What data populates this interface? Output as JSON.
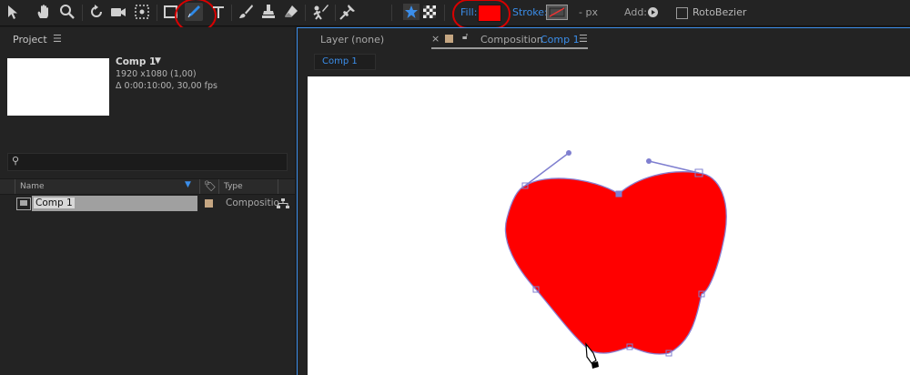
{
  "toolbar": {
    "fill_label": "Fill:",
    "fill_color": "#ff0000",
    "stroke_label": "Stroke:",
    "stroke_units": "- px",
    "add_label": "Add:",
    "rotobezier_label": "RotoBezier",
    "rotobezier_checked": false,
    "tools": [
      "selection-tool",
      "hand-tool",
      "zoom-tool",
      "rotate-tool",
      "camera-tool",
      "pan-behind-tool",
      "rectangle-tool",
      "pen-tool",
      "type-tool",
      "brush-tool",
      "clone-stamp-tool",
      "eraser-tool",
      "roto-brush-tool",
      "puppet-pin-tool"
    ],
    "active_tool": "pen-tool"
  },
  "project": {
    "panel_title": "Project",
    "comp_name": "Comp 1",
    "comp_resolution": "1920 x1080 (1,00)",
    "comp_duration": "Δ 0:00:10:00, 30,00 fps",
    "columns": {
      "name": "Name",
      "type": "Type"
    },
    "items": [
      {
        "name": "Comp 1",
        "type": "Compositio"
      }
    ]
  },
  "viewer": {
    "layer_tab": "Layer (none)",
    "composition_tab_prefix": "Composition",
    "composition_tab_name": "Comp 1",
    "breadcrumb": "Comp 1"
  },
  "shape": {
    "fill": "#ff0000",
    "stroke": "#8a7fd0"
  }
}
